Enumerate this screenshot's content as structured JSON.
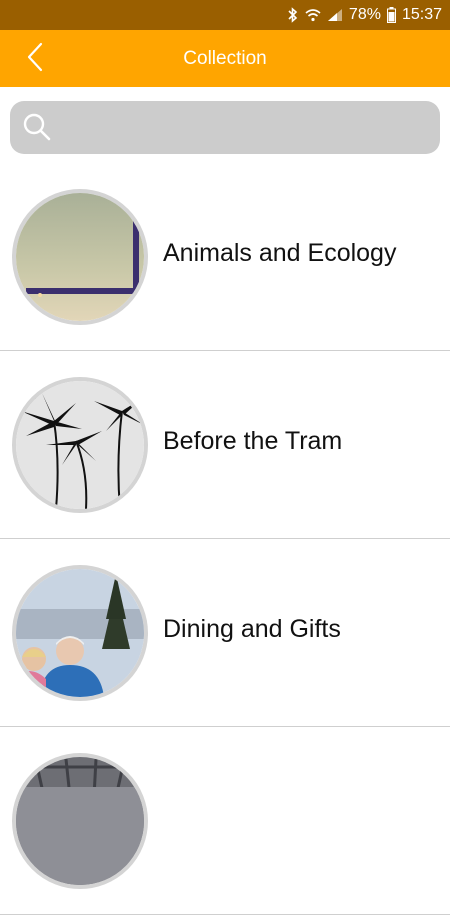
{
  "status_bar": {
    "battery": "78%",
    "time": "15:37",
    "icons": [
      "bluetooth-icon",
      "wifi-icon",
      "signal-icon",
      "battery-icon"
    ]
  },
  "header": {
    "title": "Collection",
    "back_icon": "chevron-left-icon"
  },
  "search": {
    "placeholder": "",
    "value": "",
    "icon": "search-icon"
  },
  "collection": {
    "items": [
      {
        "label": "Animals and Ecology"
      },
      {
        "label": "Before the Tram"
      },
      {
        "label": "Dining and Gifts"
      },
      {
        "label": ""
      }
    ]
  },
  "colors": {
    "status_bar": "#9a5f00",
    "app_bar": "#ffa500",
    "search_bg": "#cccccc",
    "divider": "#cfcfcf"
  }
}
